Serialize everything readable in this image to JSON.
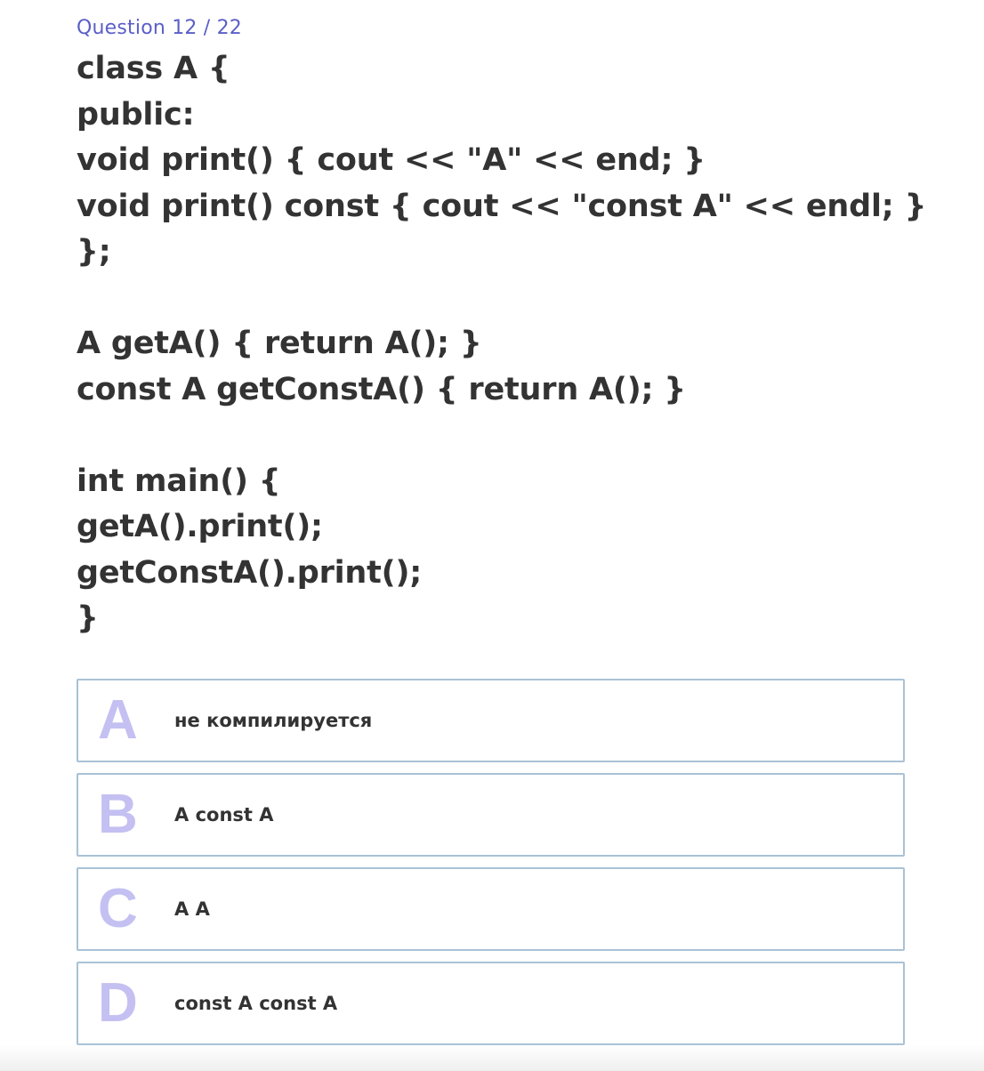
{
  "question": {
    "counter": "Question 12 / 22",
    "text": "class A {\npublic:\nvoid print() { cout << \"A\" << end; }\nvoid print() const { cout << \"const A\" << endl; }\n};\n\nA getA() { return A(); }\nconst A getConstA() { return A(); }\n\nint main() {\ngetA().print();\ngetConstA().print();\n}"
  },
  "options": [
    {
      "letter": "A",
      "text": "не компилируется"
    },
    {
      "letter": "B",
      "text": "A const A"
    },
    {
      "letter": "C",
      "text": "A A"
    },
    {
      "letter": "D",
      "text": "const A const A"
    }
  ],
  "colors": {
    "counter": "#5b5fc7",
    "letter": "#c4c0f2",
    "option_border": "#a9c2d6",
    "text": "#333333"
  }
}
